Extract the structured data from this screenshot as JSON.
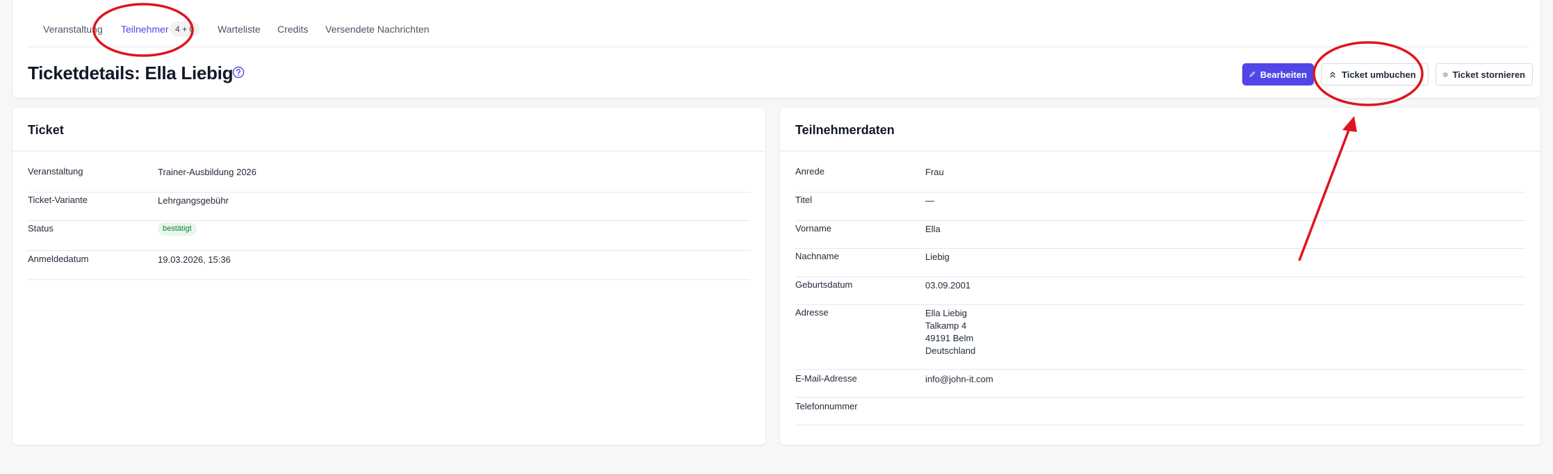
{
  "tabs": [
    {
      "label": "Veranstaltung"
    },
    {
      "label": "Teilnehmer",
      "badge": "4 + 0",
      "active": true
    },
    {
      "label": "Warteliste"
    },
    {
      "label": "Credits"
    },
    {
      "label": "Versendete Nachrichten"
    }
  ],
  "header": {
    "title": "Ticketdetails: Ella Liebig",
    "edit_label": "Bearbeiten",
    "rebook_label": "Ticket umbuchen",
    "cancel_label": "Ticket stornieren"
  },
  "ticket": {
    "title": "Ticket",
    "rows": [
      {
        "label": "Veranstaltung",
        "value": "Trainer-Ausbildung 2026"
      },
      {
        "label": "Ticket-Variante",
        "value": "Lehrgangsgebühr"
      },
      {
        "label": "Status",
        "value": "bestätigt"
      },
      {
        "label": "Anmeldedatum",
        "value": "19.03.2026, 15:36"
      }
    ]
  },
  "participant": {
    "title": "Teilnehmerdaten",
    "rows": [
      {
        "label": "Anrede",
        "value": "Frau"
      },
      {
        "label": "Titel",
        "value": "—"
      },
      {
        "label": "Vorname",
        "value": "Ella"
      },
      {
        "label": "Nachname",
        "value": "Liebig"
      },
      {
        "label": "Geburtsdatum",
        "value": "03.09.2001"
      },
      {
        "label": "Adresse",
        "lines": [
          "Ella Liebig",
          "Talkamp 4",
          "49191 Belm",
          "Deutschland"
        ]
      },
      {
        "label": "E-Mail-Adresse",
        "value": "info@john-it.com"
      },
      {
        "label": "Telefonnummer",
        "value": ""
      }
    ]
  },
  "colors": {
    "accent": "#4f46e5",
    "annotation": "#e0141c",
    "status_green": "#15803d"
  }
}
